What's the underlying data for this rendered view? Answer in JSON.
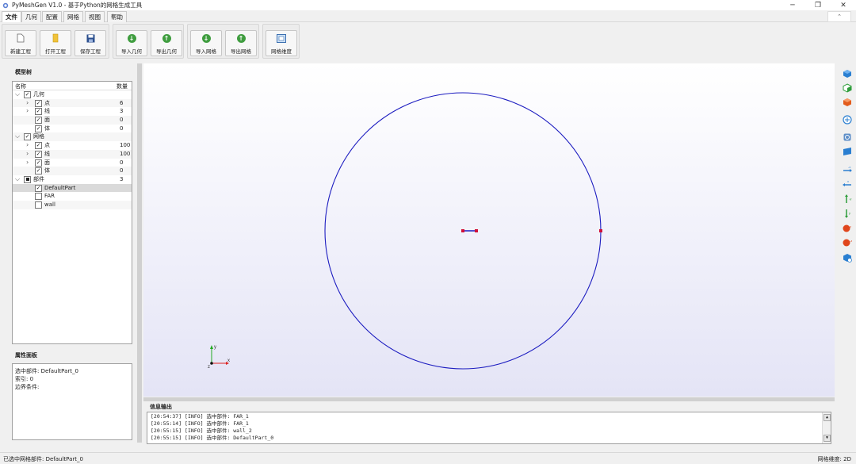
{
  "window": {
    "title": "PyMeshGen V1.0 - 基于Python的网格生成工具",
    "minimize": "─",
    "maximize": "❐",
    "close": "✕"
  },
  "menu": {
    "tabs": [
      "文件",
      "几何",
      "配置",
      "网格",
      "视图",
      "帮助"
    ],
    "active": "文件",
    "collapse_caret": "⌃"
  },
  "toolbar": {
    "groups": [
      [
        {
          "label": "新建工程",
          "icon": "new-file-icon"
        },
        {
          "label": "打开工程",
          "icon": "open-folder-icon"
        },
        {
          "label": "保存工程",
          "icon": "save-icon"
        }
      ],
      [
        {
          "label": "导入几何",
          "icon": "import-arrow-icon"
        },
        {
          "label": "导出几何",
          "icon": "export-arrow-icon"
        }
      ],
      [
        {
          "label": "导入网格",
          "icon": "import-arrow-icon"
        },
        {
          "label": "导出网格",
          "icon": "export-arrow-icon"
        }
      ],
      [
        {
          "label": "网格维度",
          "icon": "mesh-dimension-icon"
        }
      ]
    ]
  },
  "model_tree": {
    "title": "模型树",
    "columns": [
      "名称",
      "数量"
    ],
    "rows": [
      {
        "level": 0,
        "expander": "open",
        "label": "几何",
        "count": "",
        "check": "checked"
      },
      {
        "level": 1,
        "expander": "closed",
        "label": "点",
        "count": "6",
        "check": "checked"
      },
      {
        "level": 1,
        "expander": "closed",
        "label": "线",
        "count": "3",
        "check": "checked"
      },
      {
        "level": 1,
        "expander": "none",
        "label": "面",
        "count": "0",
        "check": "checked"
      },
      {
        "level": 1,
        "expander": "none",
        "label": "体",
        "count": "0",
        "check": "checked"
      },
      {
        "level": 0,
        "expander": "open",
        "label": "网格",
        "count": "",
        "check": "checked"
      },
      {
        "level": 1,
        "expander": "closed",
        "label": "点",
        "count": "100",
        "check": "checked"
      },
      {
        "level": 1,
        "expander": "closed",
        "label": "线",
        "count": "100",
        "check": "checked"
      },
      {
        "level": 1,
        "expander": "closed",
        "label": "面",
        "count": "0",
        "check": "checked"
      },
      {
        "level": 1,
        "expander": "none",
        "label": "体",
        "count": "0",
        "check": "checked"
      },
      {
        "level": 0,
        "expander": "open",
        "label": "部件",
        "count": "3",
        "check": "partial"
      },
      {
        "level": 1,
        "expander": "none",
        "label": "DefaultPart",
        "count": "",
        "check": "checked",
        "selected": true
      },
      {
        "level": 1,
        "expander": "none",
        "label": "FAR",
        "count": "",
        "check": "unchecked"
      },
      {
        "level": 1,
        "expander": "none",
        "label": "wall",
        "count": "",
        "check": "unchecked"
      }
    ]
  },
  "properties": {
    "title": "属性面板",
    "lines": [
      "选中部件: DefaultPart_0",
      "索引: 0",
      "边界条件:"
    ]
  },
  "viewport": {
    "circle_color": "#1c1cc0",
    "point_color": "#d0103a",
    "axes": {
      "x_label": "x",
      "y_label": "y",
      "z_label": "z"
    }
  },
  "log": {
    "title": "信息输出",
    "lines": [
      "[20:54:37] [INFO] 选中部件: FAR_1",
      "[20:55:14] [INFO] 选中部件: FAR_1",
      "[20:55:15] [INFO] 选中部件: wall_2",
      "[20:55:15] [INFO] 选中部件: DefaultPart_0"
    ]
  },
  "right_toolbar": [
    "iso-view-icon",
    "front-view-icon",
    "back-view-icon",
    "zoom-fit-icon",
    "rotate-view-icon",
    "surface-view-icon",
    "x-axis-icon",
    "neg-x-axis-icon",
    "y-axis-icon",
    "neg-y-axis-icon",
    "z-axis-icon",
    "neg-z-axis-icon",
    "reset-view-icon"
  ],
  "status": {
    "left": "已选中网格部件: DefaultPart_0",
    "right": "网格维度: 2D"
  }
}
